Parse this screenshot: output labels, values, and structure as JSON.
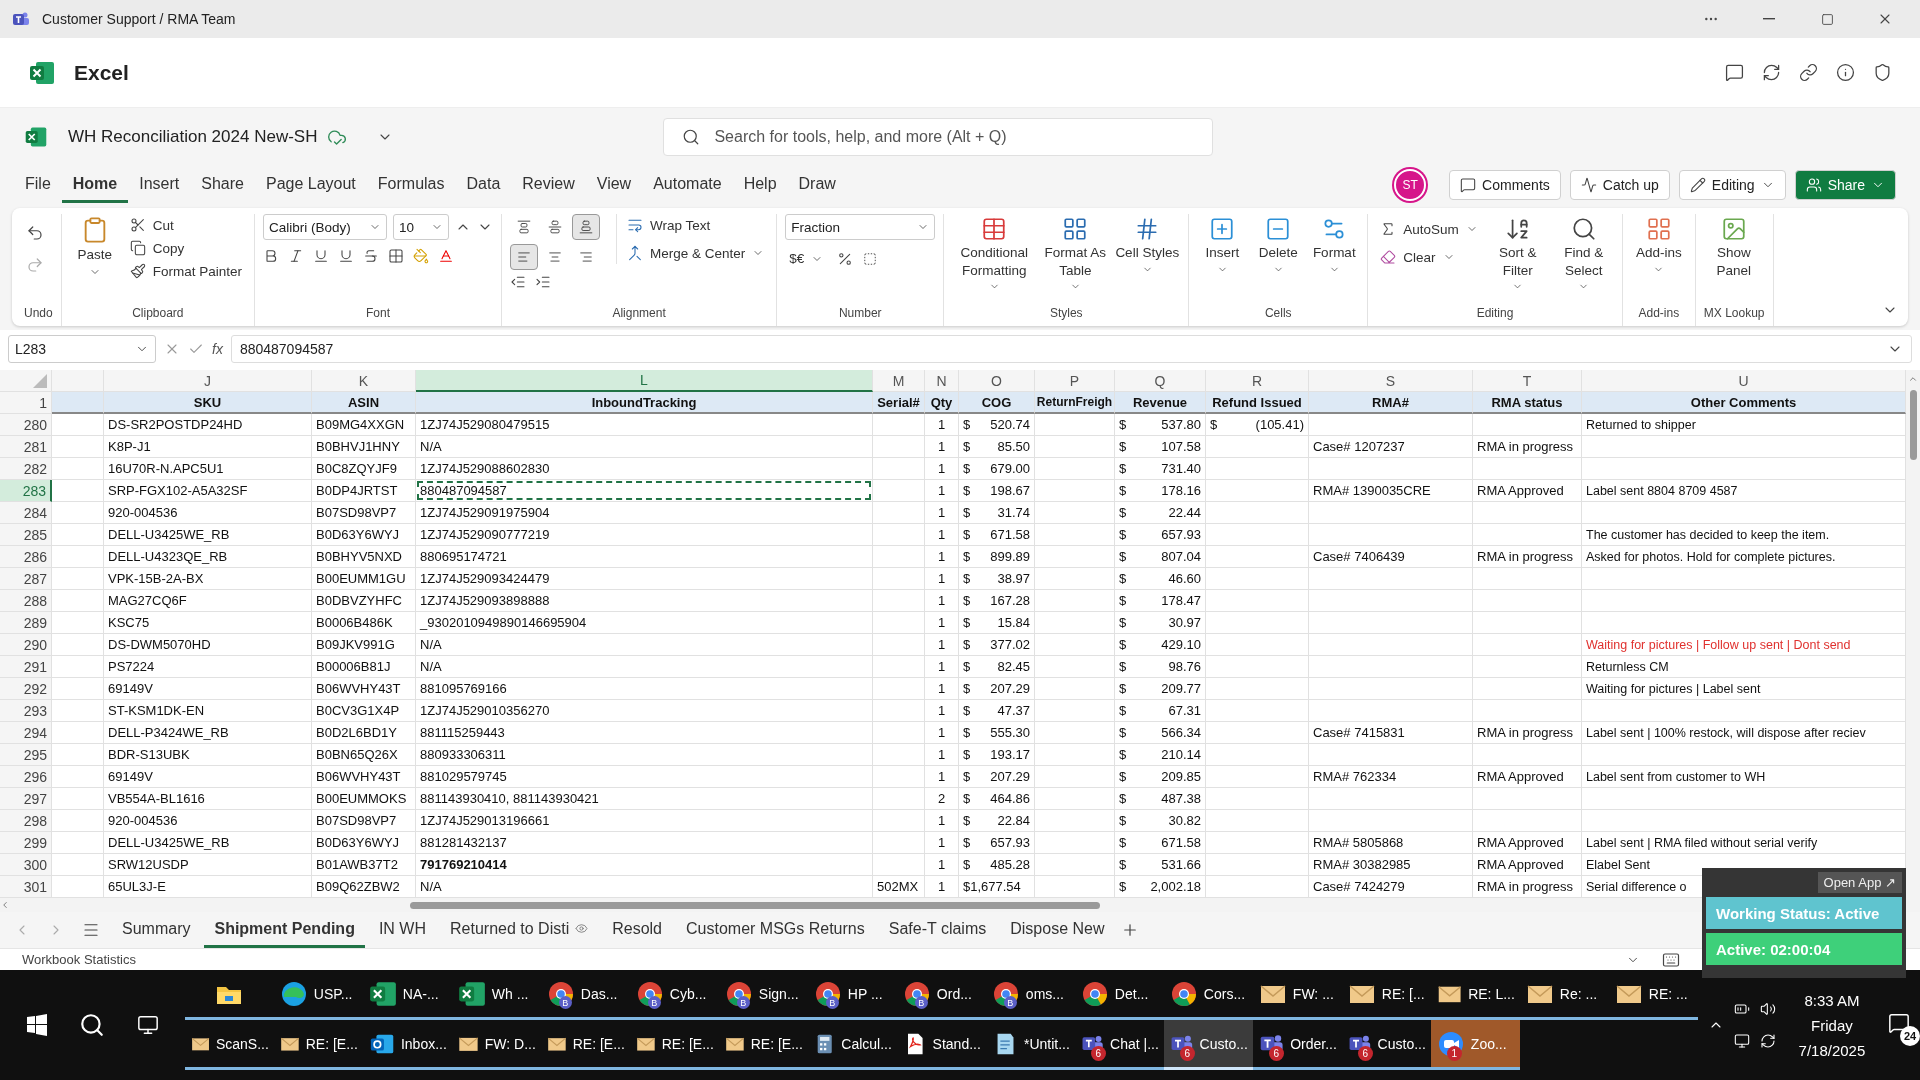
{
  "window": {
    "title": "Customer Support / RMA Team"
  },
  "app": {
    "name": "Excel"
  },
  "document": {
    "name": "WH Reconciliation 2024 New-SH"
  },
  "search": {
    "placeholder": "Search for tools, help, and more (Alt + Q)"
  },
  "menu_tabs": [
    {
      "label": "File",
      "selected": false
    },
    {
      "label": "Home",
      "selected": true
    },
    {
      "label": "Insert",
      "selected": false
    },
    {
      "label": "Share",
      "selected": false
    },
    {
      "label": "Page Layout",
      "selected": false
    },
    {
      "label": "Formulas",
      "selected": false
    },
    {
      "label": "Data",
      "selected": false
    },
    {
      "label": "Review",
      "selected": false
    },
    {
      "label": "View",
      "selected": false
    },
    {
      "label": "Automate",
      "selected": false
    },
    {
      "label": "Help",
      "selected": false
    },
    {
      "label": "Draw",
      "selected": false
    }
  ],
  "header_actions": {
    "avatar": "ST",
    "comments": "Comments",
    "catch_up": "Catch up",
    "editing": "Editing",
    "share": "Share"
  },
  "ribbon": {
    "undo": {
      "label": "Undo"
    },
    "clipboard": {
      "label": "Clipboard",
      "paste": "Paste",
      "items": [
        "Cut",
        "Copy",
        "Format Painter"
      ]
    },
    "font": {
      "label": "Font",
      "name": "Calibri (Body)",
      "size": "10"
    },
    "alignment": {
      "label": "Alignment",
      "wrap": "Wrap Text",
      "merge": "Merge & Center",
      "toggles": [
        {
          "kind": "top",
          "selected": false
        },
        {
          "kind": "middle",
          "selected": false
        },
        {
          "kind": "bottom",
          "selected": true
        },
        {
          "kind": "left",
          "selected": true
        },
        {
          "kind": "center",
          "selected": false
        },
        {
          "kind": "right",
          "selected": false
        }
      ]
    },
    "number": {
      "label": "Number",
      "format": "Fraction",
      "currency": "$€"
    },
    "styles": {
      "label": "Styles",
      "items": [
        "Conditional Formatting",
        "Format As Table",
        "Cell Styles"
      ]
    },
    "cells": {
      "label": "Cells",
      "items": [
        "Insert",
        "Delete",
        "Format"
      ]
    },
    "editing": {
      "label": "Editing",
      "small": [
        "AutoSum",
        "Clear"
      ],
      "big": [
        "Sort & Filter",
        "Find & Select"
      ]
    },
    "addins": {
      "label": "Add-ins",
      "item": "Add-ins"
    },
    "mx_lookup": {
      "label": "MX Lookup",
      "item": "Show Panel"
    }
  },
  "formula_bar": {
    "name_box": "L283",
    "function_label": "fx",
    "value": "880487094587"
  },
  "header_row_number": "1",
  "columns": [
    {
      "letter": "J",
      "title": "SKU",
      "selected": false
    },
    {
      "letter": "K",
      "title": "ASIN",
      "selected": false
    },
    {
      "letter": "L",
      "title": "InboundTracking",
      "selected": true
    },
    {
      "letter": "M",
      "title": "Serial#",
      "selected": false
    },
    {
      "letter": "N",
      "title": "Qty",
      "selected": false
    },
    {
      "letter": "O",
      "title": "COG",
      "selected": false
    },
    {
      "letter": "P",
      "title": "ReturnFreigh",
      "selected": false
    },
    {
      "letter": "Q",
      "title": "Revenue",
      "selected": false
    },
    {
      "letter": "R",
      "title": "Refund Issued",
      "selected": false
    },
    {
      "letter": "S",
      "title": "RMA#",
      "selected": false
    },
    {
      "letter": "T",
      "title": "RMA status",
      "selected": false
    },
    {
      "letter": "U",
      "title": "Other Comments",
      "selected": false
    }
  ],
  "rows": [
    {
      "number": "280",
      "selected": false,
      "sku": "DS-SR2POSTDP24HD",
      "asin": "B09MG4XXGN",
      "tracking": "1ZJ74J529080479515",
      "qty": "1",
      "cog": {
        "symbol": "$",
        "amount": "520.74"
      },
      "revenue": {
        "symbol": "$",
        "amount": "537.80"
      },
      "refund": {
        "symbol": "$",
        "amount": "(105.41)"
      },
      "comment": "Returned to shipper"
    },
    {
      "number": "281",
      "selected": false,
      "sku": "K8P-J1",
      "asin": "B0BHVJ1HNY",
      "tracking": "N/A",
      "qty": "1",
      "cog": {
        "symbol": "$",
        "amount": "85.50"
      },
      "revenue": {
        "symbol": "$",
        "amount": "107.58"
      },
      "rma": "Case# 1207237",
      "status": "RMA in progress"
    },
    {
      "number": "282",
      "selected": false,
      "sku": "16U70R-N.APC5U1",
      "asin": "B0C8ZQYJF9",
      "tracking": "1ZJ74J529088602830",
      "qty": "1",
      "cog": {
        "symbol": "$",
        "amount": "679.00"
      },
      "revenue": {
        "symbol": "$",
        "amount": "731.40"
      }
    },
    {
      "number": "283",
      "selected": true,
      "sku": "SRP-FGX102-A5A32SF",
      "asin": "B0DP4JRTST",
      "tracking": "880487094587",
      "qty": "1",
      "cog": {
        "symbol": "$",
        "amount": "198.67"
      },
      "revenue": {
        "symbol": "$",
        "amount": "178.16"
      },
      "rma": "RMA# 1390035CRE",
      "status": "RMA Approved",
      "comment": "Label sent 8804 8709 4587"
    },
    {
      "number": "284",
      "selected": false,
      "sku": "920-004536",
      "asin": "B07SD98VP7",
      "tracking": "1ZJ74J529091975904",
      "qty": "1",
      "cog": {
        "symbol": "$",
        "amount": "31.74"
      },
      "revenue": {
        "symbol": "$",
        "amount": "22.44"
      }
    },
    {
      "number": "285",
      "selected": false,
      "sku": "DELL-U3425WE_RB",
      "asin": "B0D63Y6WYJ",
      "tracking": "1ZJ74J529090777219",
      "qty": "1",
      "cog": {
        "symbol": "$",
        "amount": "671.58"
      },
      "revenue": {
        "symbol": "$",
        "amount": "657.93"
      },
      "comment": "The customer has decided to keep the item."
    },
    {
      "number": "286",
      "selected": false,
      "sku": "DELL-U4323QE_RB",
      "asin": "B0BHYV5NXD",
      "tracking": "880695174721",
      "qty": "1",
      "cog": {
        "symbol": "$",
        "amount": "899.89"
      },
      "revenue": {
        "symbol": "$",
        "amount": "807.04"
      },
      "rma": "Case# 7406439",
      "status": "RMA in progress",
      "comment": "Asked for photos. Hold for complete pictures."
    },
    {
      "number": "287",
      "selected": false,
      "sku": "VPK-15B-2A-BX",
      "asin": "B00EUMM1GU",
      "tracking": "1ZJ74J529093424479",
      "qty": "1",
      "cog": {
        "symbol": "$",
        "amount": "38.97"
      },
      "revenue": {
        "symbol": "$",
        "amount": "46.60"
      }
    },
    {
      "number": "288",
      "selected": false,
      "sku": "MAG27CQ6F",
      "asin": "B0DBVZYHFC",
      "tracking": "1ZJ74J529093898888",
      "qty": "1",
      "cog": {
        "symbol": "$",
        "amount": "167.28"
      },
      "revenue": {
        "symbol": "$",
        "amount": "178.47"
      }
    },
    {
      "number": "289",
      "selected": false,
      "sku": "KSC75",
      "asin": "B0006B486K",
      "tracking": "_9302010949890146695904",
      "qty": "1",
      "cog": {
        "symbol": "$",
        "amount": "15.84"
      },
      "revenue": {
        "symbol": "$",
        "amount": "30.97"
      }
    },
    {
      "number": "290",
      "selected": false,
      "sku": "DS-DWM5070HD",
      "asin": "B09JKV991G",
      "tracking": "N/A",
      "qty": "1",
      "cog": {
        "symbol": "$",
        "amount": "377.02"
      },
      "revenue": {
        "symbol": "$",
        "amount": "429.10"
      },
      "comment": "Waiting for pictures | Follow up sent | Dont send",
      "color": "#e0312e"
    },
    {
      "number": "291",
      "selected": false,
      "sku": "PS7224",
      "asin": "B00006B81J",
      "tracking": "N/A",
      "qty": "1",
      "cog": {
        "symbol": "$",
        "amount": "82.45"
      },
      "revenue": {
        "symbol": "$",
        "amount": "98.76"
      },
      "comment": "Returnless CM"
    },
    {
      "number": "292",
      "selected": false,
      "sku": "69149V",
      "asin": "B06WVHY43T",
      "tracking": "881095769166",
      "qty": "1",
      "cog": {
        "symbol": "$",
        "amount": "207.29"
      },
      "revenue": {
        "symbol": "$",
        "amount": "209.77"
      },
      "comment": "Waiting for pictures | Label sent"
    },
    {
      "number": "293",
      "selected": false,
      "sku": "ST-KSM1DK-EN",
      "asin": "B0CV3G1X4P",
      "tracking": "1ZJ74J529010356270",
      "qty": "1",
      "cog": {
        "symbol": "$",
        "amount": "47.37"
      },
      "revenue": {
        "symbol": "$",
        "amount": "67.31"
      }
    },
    {
      "number": "294",
      "selected": false,
      "sku": "DELL-P3424WE_RB",
      "asin": "B0D2L6BD1Y",
      "tracking": "881115259443",
      "qty": "1",
      "cog": {
        "symbol": "$",
        "amount": "555.30"
      },
      "revenue": {
        "symbol": "$",
        "amount": "566.34"
      },
      "rma": "Case# 7415831",
      "status": "RMA in progress",
      "comment": "Label sent | 100% restock, will dispose after reciev"
    },
    {
      "number": "295",
      "selected": false,
      "sku": "BDR-S13UBK",
      "asin": "B0BN65Q26X",
      "tracking": "880933306311",
      "qty": "1",
      "cog": {
        "symbol": "$",
        "amount": "193.17"
      },
      "revenue": {
        "symbol": "$",
        "amount": "210.14"
      }
    },
    {
      "number": "296",
      "selected": false,
      "sku": "69149V",
      "asin": "B06WVHY43T",
      "tracking": "881029579745",
      "qty": "1",
      "cog": {
        "symbol": "$",
        "amount": "207.29"
      },
      "revenue": {
        "symbol": "$",
        "amount": "209.85"
      },
      "rma": "RMA# 762334",
      "status": "RMA Approved",
      "comment": "Label sent from customer to WH"
    },
    {
      "number": "297",
      "selected": false,
      "sku": "VB554A-BL1616",
      "asin": "B00EUMMOKS",
      "tracking": "881143930410, 881143930421",
      "qty": "2",
      "cog": {
        "symbol": "$",
        "amount": "464.86"
      },
      "revenue": {
        "symbol": "$",
        "amount": "487.38"
      }
    },
    {
      "number": "298",
      "selected": false,
      "sku": "920-004536",
      "asin": "B07SD98VP7",
      "tracking": "1ZJ74J529013196661",
      "qty": "1",
      "cog": {
        "symbol": "$",
        "amount": "22.84"
      },
      "revenue": {
        "symbol": "$",
        "amount": "30.82"
      }
    },
    {
      "number": "299",
      "selected": false,
      "sku": "DELL-U3425WE_RB",
      "asin": "B0D63Y6WYJ",
      "tracking": "881281432137",
      "qty": "1",
      "cog": {
        "symbol": "$",
        "amount": "657.93"
      },
      "revenue": {
        "symbol": "$",
        "amount": "671.58"
      },
      "rma": "RMA# 5805868",
      "status": "RMA Approved",
      "comment": "Label sent | RMA filed without serial verify"
    },
    {
      "number": "300",
      "selected": false,
      "sku": "SRW12USDP",
      "asin": "B01AWB37T2",
      "tracking": "791769210414",
      "tracking_bold": true,
      "qty": "1",
      "cog": {
        "symbol": "$",
        "amount": "485.28"
      },
      "revenue": {
        "symbol": "$",
        "amount": "531.66"
      },
      "rma": "RMA# 30382985",
      "status": "RMA Approved",
      "comment": "Elabel Sent"
    },
    {
      "number": "301",
      "selected": false,
      "sku": "65UL3J-E",
      "asin": "B09Q62ZBW2",
      "tracking": "N/A",
      "serial": "502MX",
      "qty": "1",
      "cog": {
        "amount": "$1,677.54"
      },
      "revenue": {
        "symbol": "$",
        "amount": "2,002.18"
      },
      "rma": "Case# 7424279",
      "status": "RMA in progress",
      "comment": "Serial difference o"
    }
  ],
  "sheet_tabs": [
    {
      "label": "Summary",
      "selected": false,
      "eye": false
    },
    {
      "label": "Shipment Pending",
      "selected": true,
      "eye": false
    },
    {
      "label": "IN WH",
      "selected": false,
      "eye": false
    },
    {
      "label": "Returned to Disti",
      "selected": false,
      "eye": true
    },
    {
      "label": "Resold",
      "selected": false,
      "eye": false
    },
    {
      "label": "Customer MSGs Returns",
      "selected": false,
      "eye": false
    },
    {
      "label": "Safe-T claims",
      "selected": false,
      "eye": false
    },
    {
      "label": "Dispose New",
      "selected": false,
      "eye": false
    }
  ],
  "status_bar": {
    "text": "Workbook Statistics"
  },
  "overlay": {
    "open_app": "Open App ↗",
    "status": "Working Status: Active",
    "timer": "Active: 02:00:04"
  },
  "taskbar": {
    "rows": [
      [
        {
          "kind": "folder",
          "selected": false,
          "flashing": false
        },
        {
          "kind": "edge",
          "label": "USP...",
          "selected": false,
          "flashing": false
        },
        {
          "kind": "excel",
          "label": "NA-...",
          "selected": false,
          "flashing": false
        },
        {
          "kind": "excel",
          "label": "Wh ...",
          "selected": false,
          "flashing": false
        },
        {
          "kind": "chrome",
          "label": "Das...",
          "profile": "B",
          "selected": false,
          "flashing": false
        },
        {
          "kind": "chrome",
          "label": "Cyb...",
          "profile": "B",
          "selected": false,
          "flashing": false
        },
        {
          "kind": "chrome",
          "label": "Sign...",
          "profile": "B",
          "selected": false,
          "flashing": false
        },
        {
          "kind": "chrome",
          "label": "HP ...",
          "profile": "B",
          "selected": false,
          "flashing": false
        },
        {
          "kind": "chrome",
          "label": "Ord...",
          "profile": "B",
          "selected": false,
          "flashing": false
        },
        {
          "kind": "chrome",
          "label": "oms...",
          "profile": "B",
          "selected": false,
          "flashing": false
        },
        {
          "kind": "chrome",
          "label": "Det...",
          "selected": false,
          "flashing": false
        },
        {
          "kind": "chrome",
          "label": "Cors...",
          "selected": false,
          "flashing": false
        },
        {
          "kind": "mail",
          "label": "FW: ...",
          "selected": false,
          "flashing": false
        },
        {
          "kind": "mail",
          "label": "RE: [...",
          "selected": false,
          "flashing": false
        },
        {
          "kind": "mail",
          "label": "RE: L...",
          "selected": false,
          "flashing": false
        },
        {
          "kind": "mail",
          "label": "Re: ...",
          "selected": false,
          "flashing": false
        },
        {
          "kind": "mail",
          "label": "RE: ...",
          "selected": false,
          "flashing": false
        }
      ],
      [
        {
          "kind": "mail",
          "label": "ScanS...",
          "selected": false,
          "flashing": false
        },
        {
          "kind": "mail",
          "label": "RE: [E...",
          "selected": false,
          "flashing": false
        },
        {
          "kind": "outlook",
          "label": "Inbox...",
          "selected": false,
          "flashing": false
        },
        {
          "kind": "mail",
          "label": "FW: D...",
          "selected": false,
          "flashing": false
        },
        {
          "kind": "mail",
          "label": "RE: [E...",
          "selected": false,
          "flashing": false
        },
        {
          "kind": "mail",
          "label": "RE: [E...",
          "selected": false,
          "flashing": false
        },
        {
          "kind": "mail",
          "label": "RE: [E...",
          "selected": false,
          "flashing": false
        },
        {
          "kind": "calc",
          "label": "Calcul...",
          "selected": false,
          "flashing": false
        },
        {
          "kind": "pdf",
          "label": "Stand...",
          "selected": false,
          "flashing": false
        },
        {
          "kind": "notepad",
          "label": "*Untit...",
          "selected": false,
          "flashing": false
        },
        {
          "kind": "teams",
          "label": "Chat |...",
          "badge": "6",
          "selected": false,
          "flashing": false
        },
        {
          "kind": "teams",
          "label": "Custo...",
          "badge": "6",
          "selected": true,
          "flashing": false
        },
        {
          "kind": "teams",
          "label": "Order...",
          "badge": "6",
          "selected": false,
          "flashing": false
        },
        {
          "kind": "teams",
          "label": "Custo...",
          "badge": "6",
          "selected": false,
          "flashing": false
        },
        {
          "kind": "zoom",
          "label": "Zoo...",
          "badge": "1",
          "selected": false,
          "flashing": true
        }
      ]
    ],
    "time": "8:33 AM",
    "day": "Friday",
    "date": "7/18/2025",
    "notifications": "24"
  }
}
